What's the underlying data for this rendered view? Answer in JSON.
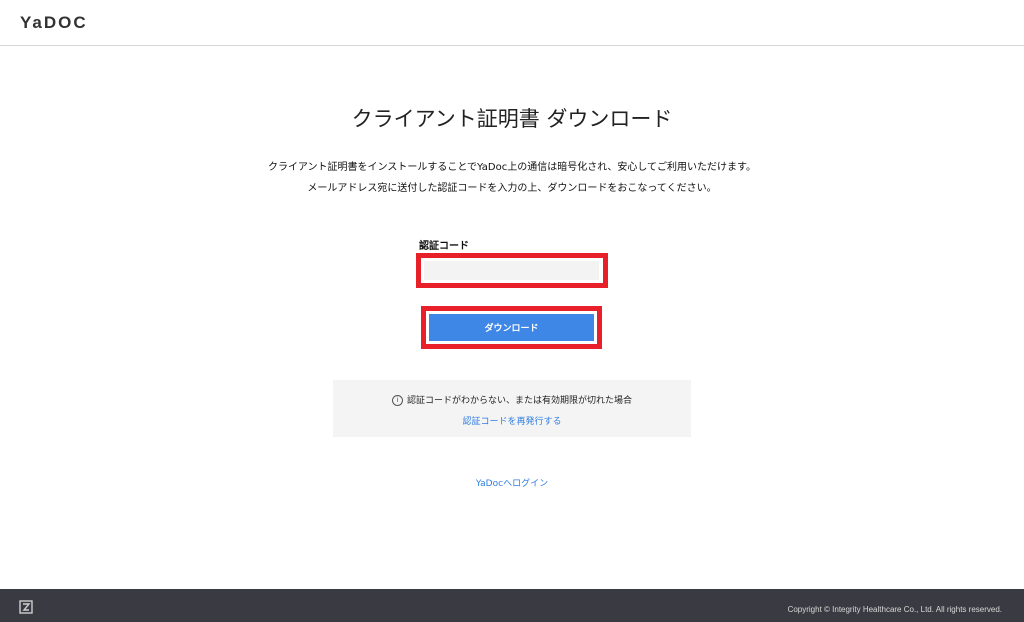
{
  "header": {
    "logo_text": "YaDOC"
  },
  "main": {
    "title": "クライアント証明書 ダウンロード",
    "description_line1": "クライアント証明書をインストールすることでYaDoc上の通信は暗号化され、安心してご利用いただけます。",
    "description_line2": "メールアドレス宛に送付した認証コードを入力の上、ダウンロードをおこなってください。",
    "code_field": {
      "label": "認証コード",
      "value": "",
      "placeholder": ""
    },
    "download_button_label": "ダウンロード"
  },
  "notice": {
    "icon": "info-icon",
    "icon_glyph": "i",
    "text": "認証コードがわからない、または有効期限が切れた場合",
    "reissue_link": "認証コードを再発行する"
  },
  "login_link": "YaDocへログイン",
  "footer": {
    "copyright": "Copyright © Integrity Healthcare Co., Ltd. All rights reserved."
  },
  "colors": {
    "accent_blue": "#3f87e6",
    "link_blue": "#2f7de1",
    "highlight_red": "#e8202a",
    "footer_bg": "#3a3a42"
  }
}
